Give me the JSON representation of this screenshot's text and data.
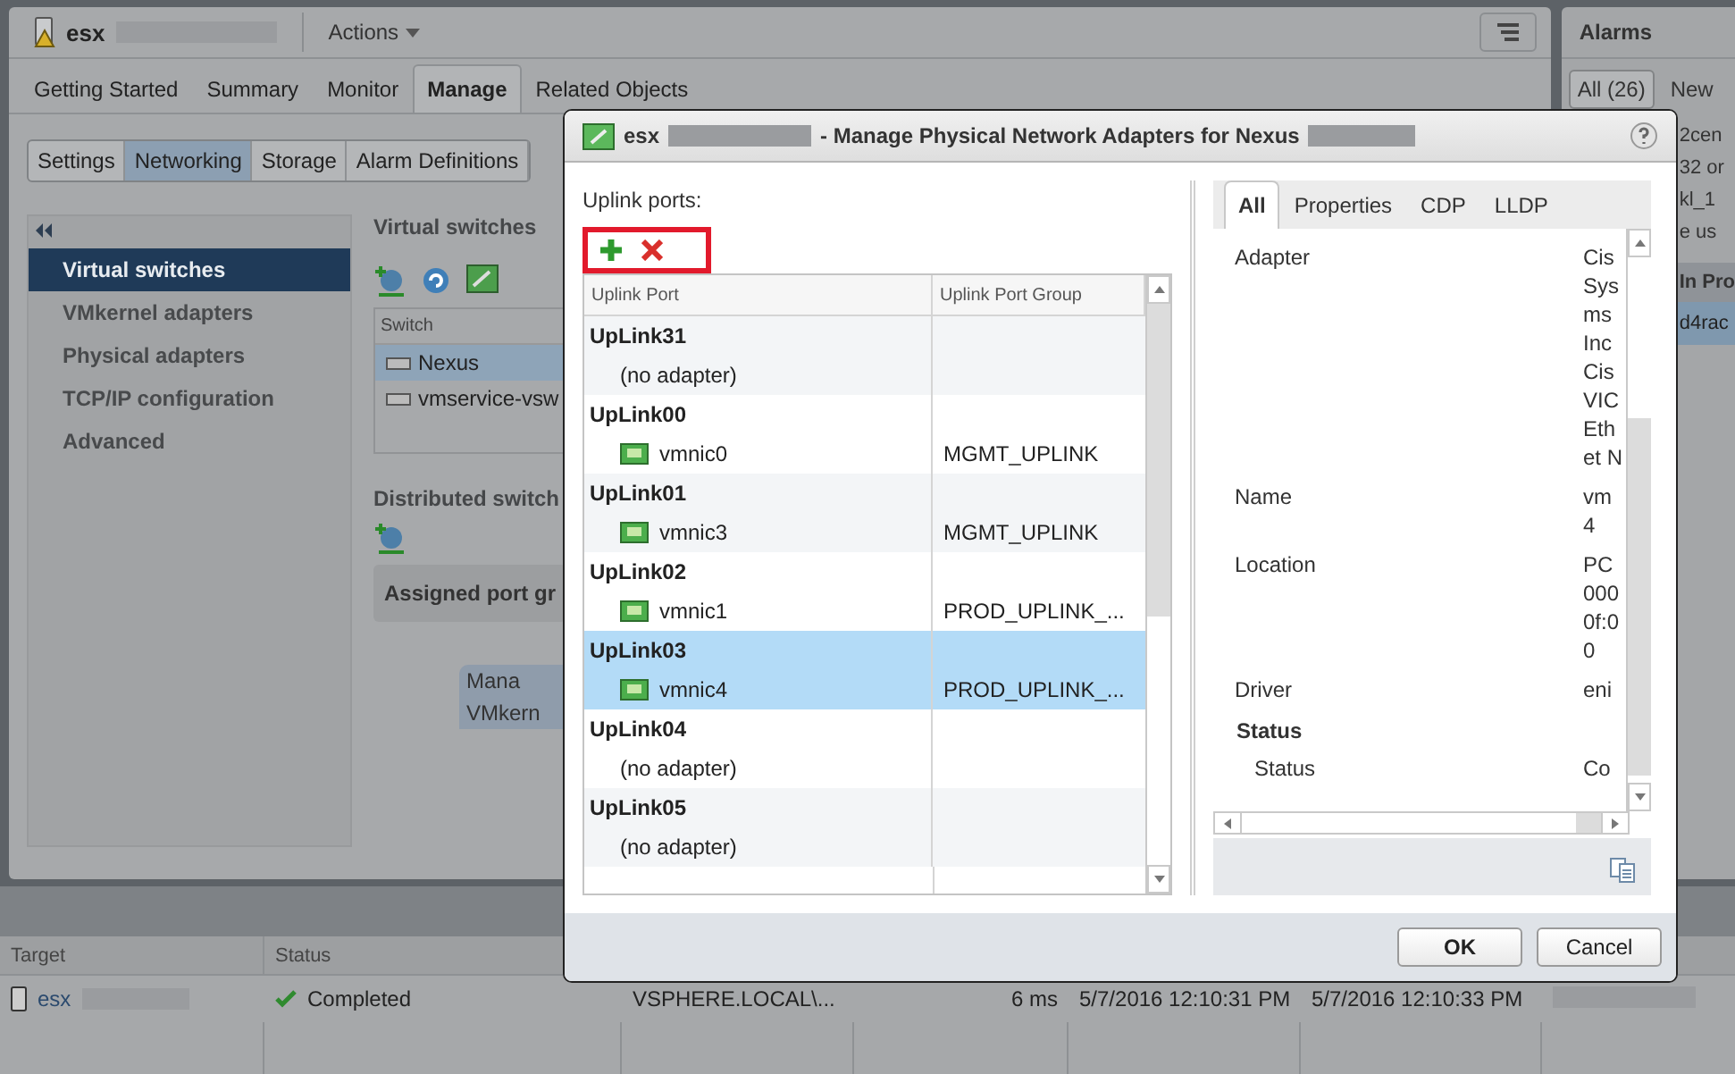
{
  "header": {
    "host": "esx",
    "actions": "Actions"
  },
  "tabs": [
    {
      "label": "Getting Started",
      "selected": false
    },
    {
      "label": "Summary",
      "selected": false
    },
    {
      "label": "Monitor",
      "selected": false
    },
    {
      "label": "Manage",
      "selected": true
    },
    {
      "label": "Related Objects",
      "selected": false
    }
  ],
  "subtabs": [
    {
      "label": "Settings",
      "selected": false
    },
    {
      "label": "Networking",
      "selected": true
    },
    {
      "label": "Storage",
      "selected": false
    },
    {
      "label": "Alarm Definitions",
      "selected": false
    }
  ],
  "nav_items": [
    {
      "label": "Virtual switches",
      "selected": true
    },
    {
      "label": "VMkernel adapters",
      "selected": false
    },
    {
      "label": "Physical adapters",
      "selected": false
    },
    {
      "label": "TCP/IP configuration",
      "selected": false
    },
    {
      "label": "Advanced",
      "selected": false
    }
  ],
  "virtual_switches": {
    "title": "Virtual switches",
    "column": "Switch",
    "rows": [
      {
        "name": "Nexus",
        "selected": true
      },
      {
        "name": "vmservice-vsw",
        "selected": false
      }
    ]
  },
  "distributed": {
    "title": "Distributed switch",
    "assigned": "Assigned port gr",
    "items": [
      "Mana",
      "VMkern"
    ]
  },
  "alarms": {
    "title": "Alarms",
    "tabs": [
      {
        "label": "All (26)",
        "selected": true
      },
      {
        "label": "New",
        "selected": false
      }
    ],
    "items": [
      "2cen",
      "32 or",
      "kl_1",
      "e us"
    ],
    "section": "In Pro",
    "selected_item": "d4rac"
  },
  "tasks": {
    "columns": [
      "Target",
      "Status"
    ],
    "row": {
      "target": "esx",
      "status": "Completed",
      "cells": [
        "VSPHERE.LOCAL\\...",
        "6 ms",
        "5/7/2016 12:10:31 PM",
        "5/7/2016 12:10:33 PM"
      ]
    }
  },
  "dialog": {
    "host": "esx",
    "title": "- Manage Physical Network Adapters for Nexus",
    "uplink_label": "Uplink ports:",
    "columns": [
      "Uplink Port",
      "Uplink Port Group"
    ],
    "uplinks": [
      {
        "port": "UpLink31",
        "kind": "empty",
        "adapter": "(no adapter)",
        "selected": false
      },
      {
        "port": "UpLink00",
        "kind": "nic",
        "adapter": "vmnic0",
        "group": "MGMT_UPLINK",
        "selected": false
      },
      {
        "port": "UpLink01",
        "kind": "nic",
        "adapter": "vmnic3",
        "group": "MGMT_UPLINK",
        "selected": false
      },
      {
        "port": "UpLink02",
        "kind": "nic",
        "adapter": "vmnic1",
        "group": "PROD_UPLINK_...",
        "selected": false
      },
      {
        "port": "UpLink03",
        "kind": "nic",
        "adapter": "vmnic4",
        "group": "PROD_UPLINK_...",
        "selected": true
      },
      {
        "port": "UpLink04",
        "kind": "empty",
        "adapter": "(no adapter)",
        "selected": false
      },
      {
        "port": "UpLink05",
        "kind": "empty",
        "adapter": "(no adapter)",
        "selected": false
      }
    ],
    "detail_tabs": [
      {
        "label": "All",
        "selected": true
      },
      {
        "label": "Properties",
        "selected": false
      },
      {
        "label": "CDP",
        "selected": false
      },
      {
        "label": "LLDP",
        "selected": false
      }
    ],
    "properties": [
      {
        "kind": "property",
        "label": "Adapter",
        "lines": [
          "Cis",
          "Sys",
          "ms",
          "Inc",
          "Cis",
          "VIC",
          "Eth",
          "et N"
        ]
      },
      {
        "kind": "property",
        "label": "Name",
        "lines": [
          "vm",
          "4"
        ]
      },
      {
        "kind": "property",
        "label": "Location",
        "lines": [
          "PC",
          "000",
          "0f:0",
          "0"
        ]
      },
      {
        "kind": "property",
        "label": "Driver",
        "lines": [
          "eni"
        ]
      },
      {
        "kind": "section",
        "label": "Status"
      },
      {
        "kind": "subproperty",
        "label": "Status",
        "lines": [
          "Co"
        ]
      }
    ],
    "buttons": [
      "OK",
      "Cancel"
    ]
  }
}
